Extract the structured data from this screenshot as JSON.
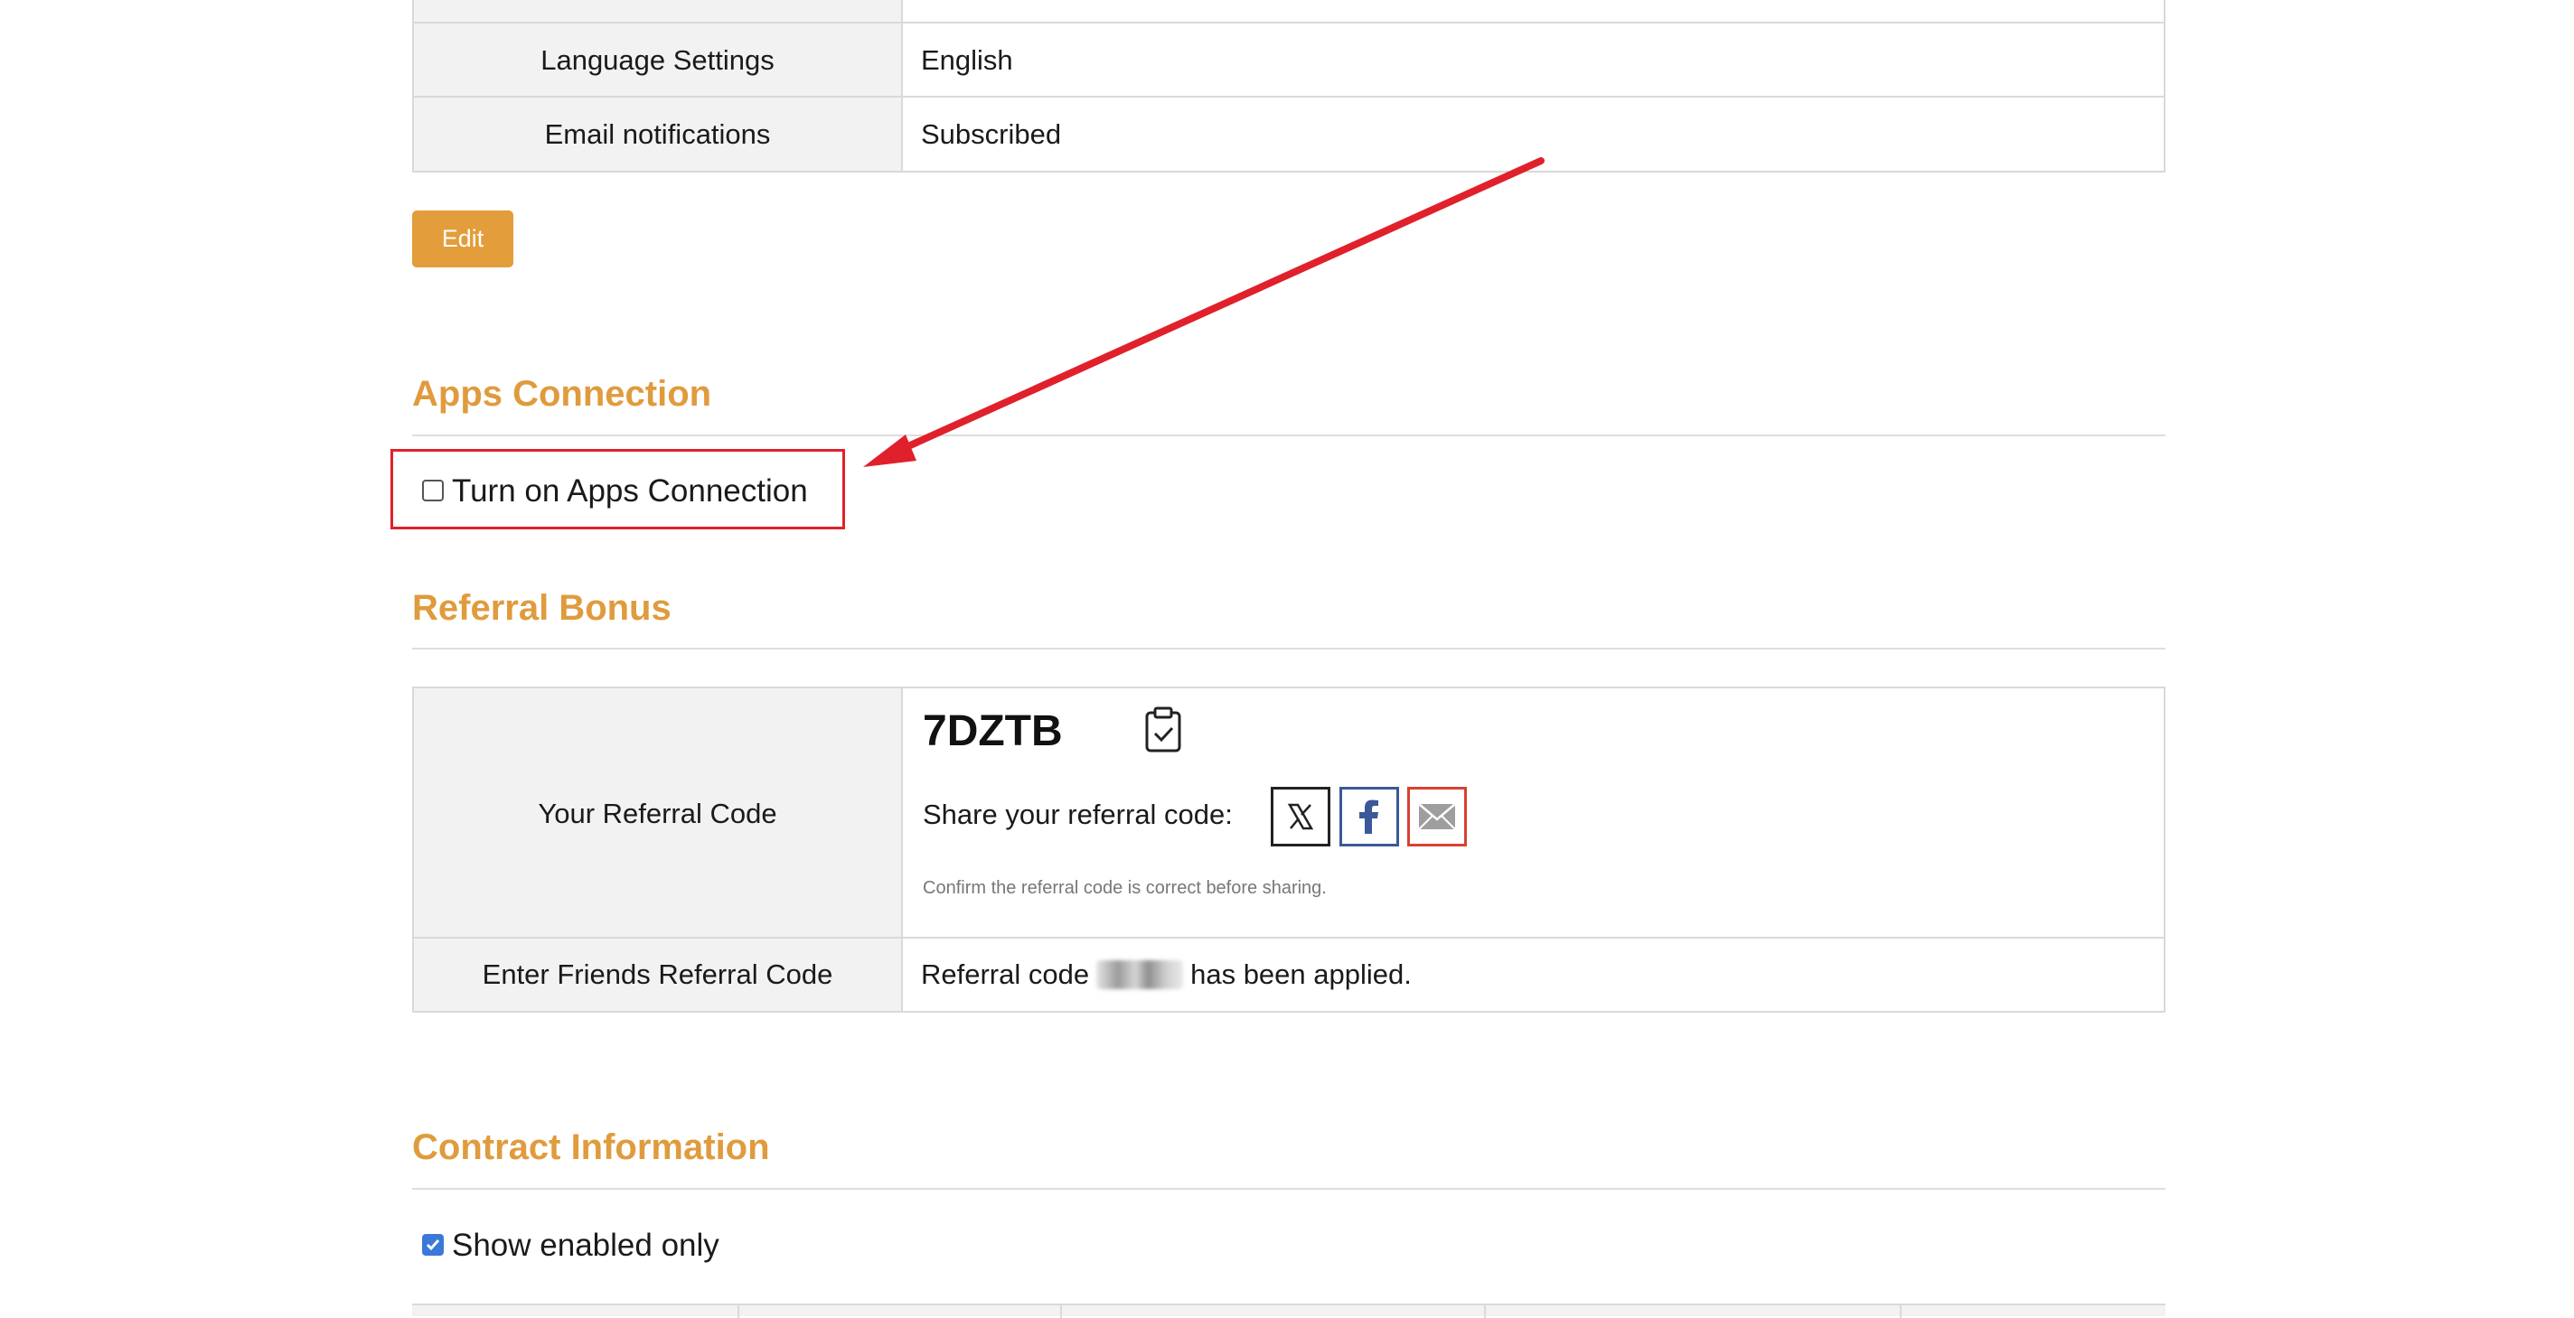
{
  "settings": {
    "rows": [
      {
        "label": "Language Settings",
        "value": "English"
      },
      {
        "label": "Email notifications",
        "value": "Subscribed"
      }
    ],
    "edit_label": "Edit"
  },
  "apps": {
    "title": "Apps Connection",
    "checkbox_label": "Turn on Apps Connection",
    "checked": false
  },
  "referral": {
    "title": "Referral Bonus",
    "your_code_label": "Your Referral Code",
    "code": "7DZTB",
    "share_label": "Share your referral code:",
    "note": "Confirm the referral code is correct before sharing.",
    "friends_label": "Enter Friends Referral Code",
    "applied_prefix": "Referral code",
    "applied_suffix": "has been applied."
  },
  "contract": {
    "title": "Contract Information",
    "show_enabled_label": "Show enabled only",
    "checked": true
  },
  "icons": [
    "clipboard-check-icon",
    "x-twitter-icon",
    "facebook-icon",
    "mail-icon"
  ],
  "colors": {
    "accent": "#e09b3d",
    "button": "#e39d3a",
    "annotation": "#e0212b",
    "checkbox": "#3b78d8"
  }
}
